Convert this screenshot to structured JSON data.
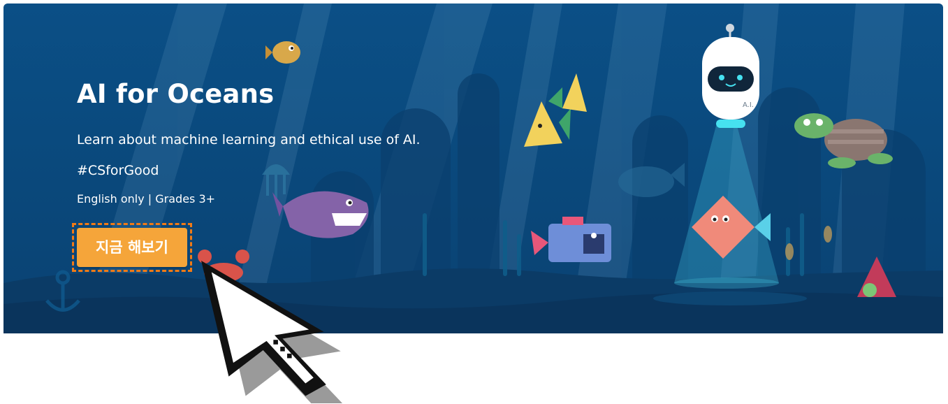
{
  "banner": {
    "title": "AI for Oceans",
    "description": "Learn about machine learning and ethical use of AI.",
    "hashtag": "#CSforGood",
    "meta": "English only | Grades 3+",
    "cta_label": "지금 해보기",
    "robot_label": "A.I."
  },
  "colors": {
    "ocean_top": "#0b4f86",
    "ocean_bottom": "#0a4272",
    "cta_background": "#f5a53a",
    "cta_highlight_border": "#f07a16",
    "text": "#ffffff"
  },
  "icons": {
    "cursor": "hand-pointer-icon"
  }
}
